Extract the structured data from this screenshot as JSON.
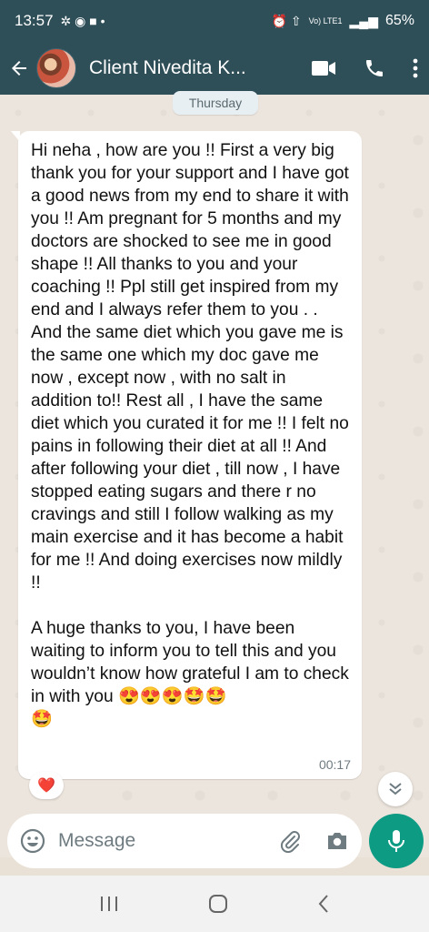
{
  "status_bar": {
    "time": "13:57",
    "battery": "65%",
    "network": "Vo) LTE1"
  },
  "header": {
    "contact_name": "Client Nivedita K...",
    "icons": [
      "back-arrow-icon",
      "video-call-icon",
      "phone-icon",
      "more-options-icon"
    ]
  },
  "chat": {
    "day_label": "Thursday",
    "message": {
      "text": "Hi neha , how are you !! First a very big thank you for your support and I have got a good news from my end to share it with you !! Am pregnant for 5 months and my doctors are shocked to see me in good shape !! All thanks to you and your coaching !! Ppl still get inspired from my end and I always refer them to you . . And the same diet which you gave me is the same one which my doc gave me now , except now , with no salt in addition to!! Rest all , I have the same diet which you curated it for me !! I felt no pains in following their diet at all !! And after following your diet , till now , I have stopped eating sugars and there r no cravings and still I follow walking as my main exercise and it has become a habit for me !! And doing exercises now mildly !!\n\nA huge thanks to you, I have been waiting to inform you to tell this and you wouldn’t know how grateful I am to check in with you 😍😍😍🤩🤩\n🤩",
      "time": "00:17"
    },
    "reaction": "❤️"
  },
  "composer": {
    "placeholder": "Message"
  },
  "colors": {
    "header_bg": "#2f4f58",
    "chat_bg": "#ece5dd",
    "mic_button": "#0e9b84"
  }
}
